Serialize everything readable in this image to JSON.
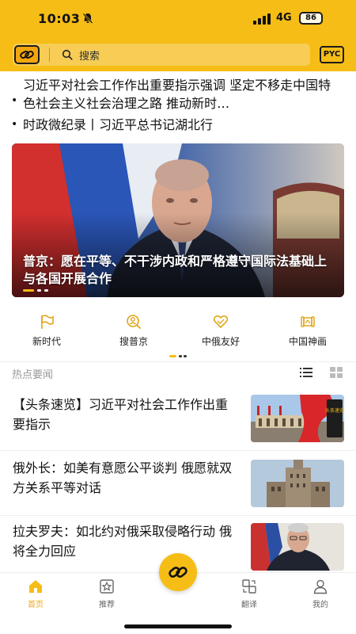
{
  "status_bar": {
    "time": "10:03",
    "network": "4G",
    "battery": "86"
  },
  "header": {
    "search_placeholder": "搜索",
    "lang_button": "PYC"
  },
  "headlines": [
    {
      "text": "习近平对社会工作作出重要指示强调 坚定不移走中国特色社会主义社会治理之路 推动新时…"
    },
    {
      "text": "时政微纪录丨习近平总书记湖北行"
    }
  ],
  "hero": {
    "caption": "普京：愿在平等、不干涉内政和严格遵守国际法基础上与各国开展合作"
  },
  "quick_nav": [
    {
      "label": "新时代",
      "icon": "flag-icon"
    },
    {
      "label": "搜普京",
      "icon": "search-person-icon"
    },
    {
      "label": "中俄友好",
      "icon": "heart-handshake-icon"
    },
    {
      "label": "中国神画",
      "icon": "scroll-icon"
    }
  ],
  "section": {
    "title": "热点要闻"
  },
  "news": [
    {
      "title": "【头条速览】习近平对社会工作作出重要指示",
      "thumb_label": "头条速览"
    },
    {
      "title": "俄外长：如美有意愿公平谈判 俄愿就双方关系平等对话"
    },
    {
      "title": "拉夫罗夫：如北约对俄采取侵略行动 俄将全力回应"
    }
  ],
  "tabs": [
    {
      "label": "首页",
      "icon": "home-icon",
      "active": true
    },
    {
      "label": "推荐",
      "icon": "star-icon",
      "active": false
    },
    {
      "label": "翻译",
      "icon": "translate-icon",
      "active": false
    },
    {
      "label": "我的",
      "icon": "user-icon",
      "active": false
    }
  ],
  "colors": {
    "brand": "#f6bd16",
    "active_tab": "#f0a818"
  }
}
